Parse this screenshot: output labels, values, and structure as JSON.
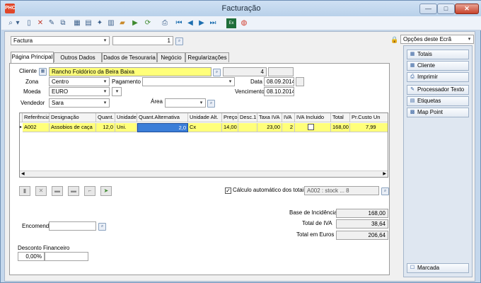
{
  "window": {
    "title": "Facturação",
    "app_icon": "PHC"
  },
  "toolbar": {
    "icons": [
      "search-icon",
      "dropdown-arrow-icon",
      "new-document-icon",
      "delete-icon",
      "edit-icon",
      "copy-icon",
      "grid-icon",
      "calendar-icon",
      "wizard-icon",
      "report-icon",
      "folder-icon",
      "refresh-icon",
      "preview-icon",
      "first-record-icon",
      "previous-record-icon",
      "next-record-icon",
      "last-record-icon",
      "excel-icon",
      "help-icon"
    ]
  },
  "header": {
    "document_type": "Factura",
    "doc_number": "1"
  },
  "options": {
    "label": "Opções deste Ecrã",
    "lock_icon": "lock-icon"
  },
  "tabs": [
    "Página Principal",
    "Outros Dados",
    "Dados de Tesouraria",
    "Negócio",
    "Regularizações"
  ],
  "form": {
    "cliente_label": "Cliente",
    "cliente_name": "Rancho Foldórico da Beira Baixa",
    "cliente_num": "4",
    "zona_label": "Zona",
    "zona_value": "Centro",
    "pagamento_label": "Pagamento",
    "data_label": "Data",
    "data_value": "08.09.2014",
    "moeda_label": "Moeda",
    "moeda_value": "EURO",
    "vencimento_label": "Vencimento",
    "vencimento_value": "08.10.2014",
    "vendedor_label": "Vendedor",
    "vendedor_value": "Sara",
    "area_label": "Área"
  },
  "grid": {
    "columns": [
      "Referência",
      "Designação",
      "Quant.",
      "Unidade",
      "Quant.Alternativa",
      "Unidade Alt.",
      "Preço",
      "Desc.1",
      "Taxa IVA",
      "IVA",
      "IVA Incluido",
      "Total",
      "Pr.Custo Un"
    ],
    "rows": [
      {
        "ref": "A002",
        "designacao": "Assobios de caça",
        "quant": "12,0",
        "unidade": "Uni.",
        "quant_alt": "2,0",
        "unidade_alt": "Cx",
        "preco": "14,00",
        "desc1": "",
        "taxa_iva": "23,00",
        "iva": "2",
        "iva_incluido": false,
        "total": "168,00",
        "pr_custo": "7,99"
      }
    ]
  },
  "calculo": {
    "label": "Cálculo automático dos totais",
    "checked": true,
    "stock_info": "A002 : stock ... 8"
  },
  "totais": {
    "base_label": "Base de Incidência",
    "base_value": "168,00",
    "iva_label": "Total de IVA",
    "iva_value": "38,64",
    "euros_label": "Total em Euros",
    "euros_value": "206,64"
  },
  "encomenda": {
    "label": "Encomenda",
    "value": ""
  },
  "desconto": {
    "label": "Desconto Financeiro",
    "value": "0,00%"
  },
  "side": {
    "buttons": [
      "Totais",
      "Cliente",
      "Imprimir",
      "Processador Texto",
      "Etiquetas",
      "Map Point"
    ],
    "marcada": "Marcada"
  }
}
